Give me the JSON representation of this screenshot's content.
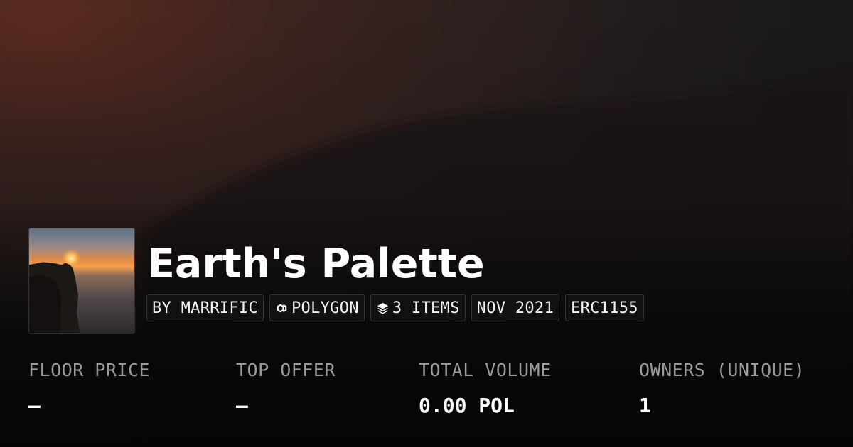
{
  "collection": {
    "name": "Earth's Palette",
    "tags": {
      "creator": "BY MARRIFIC",
      "chain": "POLYGON",
      "items": "3 ITEMS",
      "date": "NOV 2021",
      "standard": "ERC1155"
    },
    "icons": {
      "chain": "polygon-icon",
      "items": "layers-icon"
    }
  },
  "stats": {
    "floor_price": {
      "label": "FLOOR PRICE",
      "value": "–"
    },
    "top_offer": {
      "label": "TOP OFFER",
      "value": "–"
    },
    "total_volume": {
      "label": "TOTAL VOLUME",
      "value": "0.00 POL"
    },
    "owners": {
      "label": "OWNERS (UNIQUE)",
      "value": "1"
    }
  },
  "colors": {
    "background": "#0b0a0a",
    "sky_glow": "#5a2a1e",
    "text": "#ffffff",
    "muted": "#9a9a9a",
    "tag_border": "#2e2e30"
  }
}
